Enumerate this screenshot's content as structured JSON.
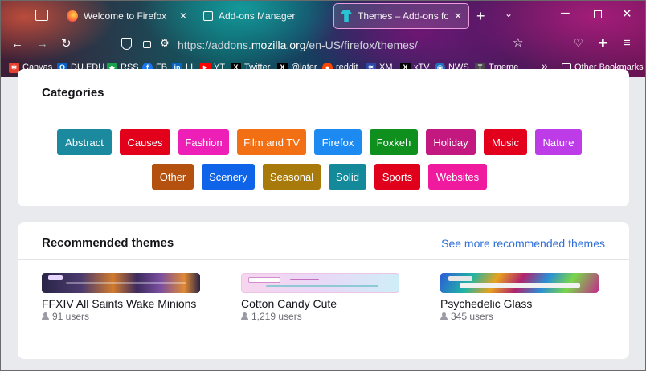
{
  "tabs": [
    {
      "title": "Welcome to Firefox",
      "icon": "firefox-icon"
    },
    {
      "title": "Add-ons Manager",
      "icon": "puzzle-icon"
    },
    {
      "title": "Themes – Add-ons for Firef",
      "icon": "theme-icon"
    }
  ],
  "url": {
    "prefix": "https://addons.",
    "domain": "mozilla.org",
    "path": "/en-US/firefox/themes/"
  },
  "bookmarks": [
    {
      "label": "Canvas",
      "icon": "canvas-icon",
      "color": "#e5412d",
      "glyph": "✱"
    },
    {
      "label": "DU.EDU",
      "icon": "outlook-icon",
      "color": "#0a64c8",
      "glyph": "O"
    },
    {
      "label": "RSS",
      "icon": "rss-icon",
      "color": "#1aa34a",
      "glyph": "◆"
    },
    {
      "label": "FB",
      "icon": "facebook-icon",
      "color": "#1877f2",
      "glyph": "f"
    },
    {
      "label": "LI",
      "icon": "linkedin-icon",
      "color": "#0a66c2",
      "glyph": "in"
    },
    {
      "label": "YT",
      "icon": "youtube-icon",
      "color": "#ff0000",
      "glyph": "▶"
    },
    {
      "label": "Twitter",
      "icon": "x-icon",
      "color": "#000000",
      "glyph": "X"
    },
    {
      "label": "@later",
      "icon": "x-icon",
      "color": "#000000",
      "glyph": "X"
    },
    {
      "label": "reddit",
      "icon": "reddit-icon",
      "color": "#ff4500",
      "glyph": "●"
    },
    {
      "label": "XM",
      "icon": "xm-icon",
      "color": "#2b4aa8",
      "glyph": "≋"
    },
    {
      "label": "xTV",
      "icon": "x-icon",
      "color": "#000000",
      "glyph": "X"
    },
    {
      "label": "NWS",
      "icon": "nws-icon",
      "color": "#1e73be",
      "glyph": "◉"
    },
    {
      "label": "Tmeme",
      "icon": "tmeme-icon",
      "color": "#4a4a4a",
      "glyph": "T"
    }
  ],
  "other_bookmarks": "Other Bookmarks",
  "categories": {
    "heading": "Categories",
    "items": [
      {
        "label": "Abstract",
        "color": "#1b8a9e"
      },
      {
        "label": "Causes",
        "color": "#e2001b"
      },
      {
        "label": "Fashion",
        "color": "#ee1fb6"
      },
      {
        "label": "Film and TV",
        "color": "#f36f13"
      },
      {
        "label": "Firefox",
        "color": "#1d8af2"
      },
      {
        "label": "Foxkeh",
        "color": "#0f8f1e"
      },
      {
        "label": "Holiday",
        "color": "#c2187f"
      },
      {
        "label": "Music",
        "color": "#e3001d"
      },
      {
        "label": "Nature",
        "color": "#bd3ce7"
      },
      {
        "label": "Other",
        "color": "#b5510f"
      },
      {
        "label": "Scenery",
        "color": "#0e63e8"
      },
      {
        "label": "Seasonal",
        "color": "#a87a0c"
      },
      {
        "label": "Solid",
        "color": "#14899a"
      },
      {
        "label": "Sports",
        "color": "#e0001b"
      },
      {
        "label": "Websites",
        "color": "#f01a9e"
      }
    ]
  },
  "recommended": {
    "heading": "Recommended themes",
    "see_more": "See more recommended themes",
    "themes": [
      {
        "name": "FFXIV All Saints Wake Minions",
        "users": "91 users"
      },
      {
        "name": "Cotton Candy Cute",
        "users": "1,219 users"
      },
      {
        "name": "Psychedelic Glass",
        "users": "345 users"
      }
    ]
  }
}
